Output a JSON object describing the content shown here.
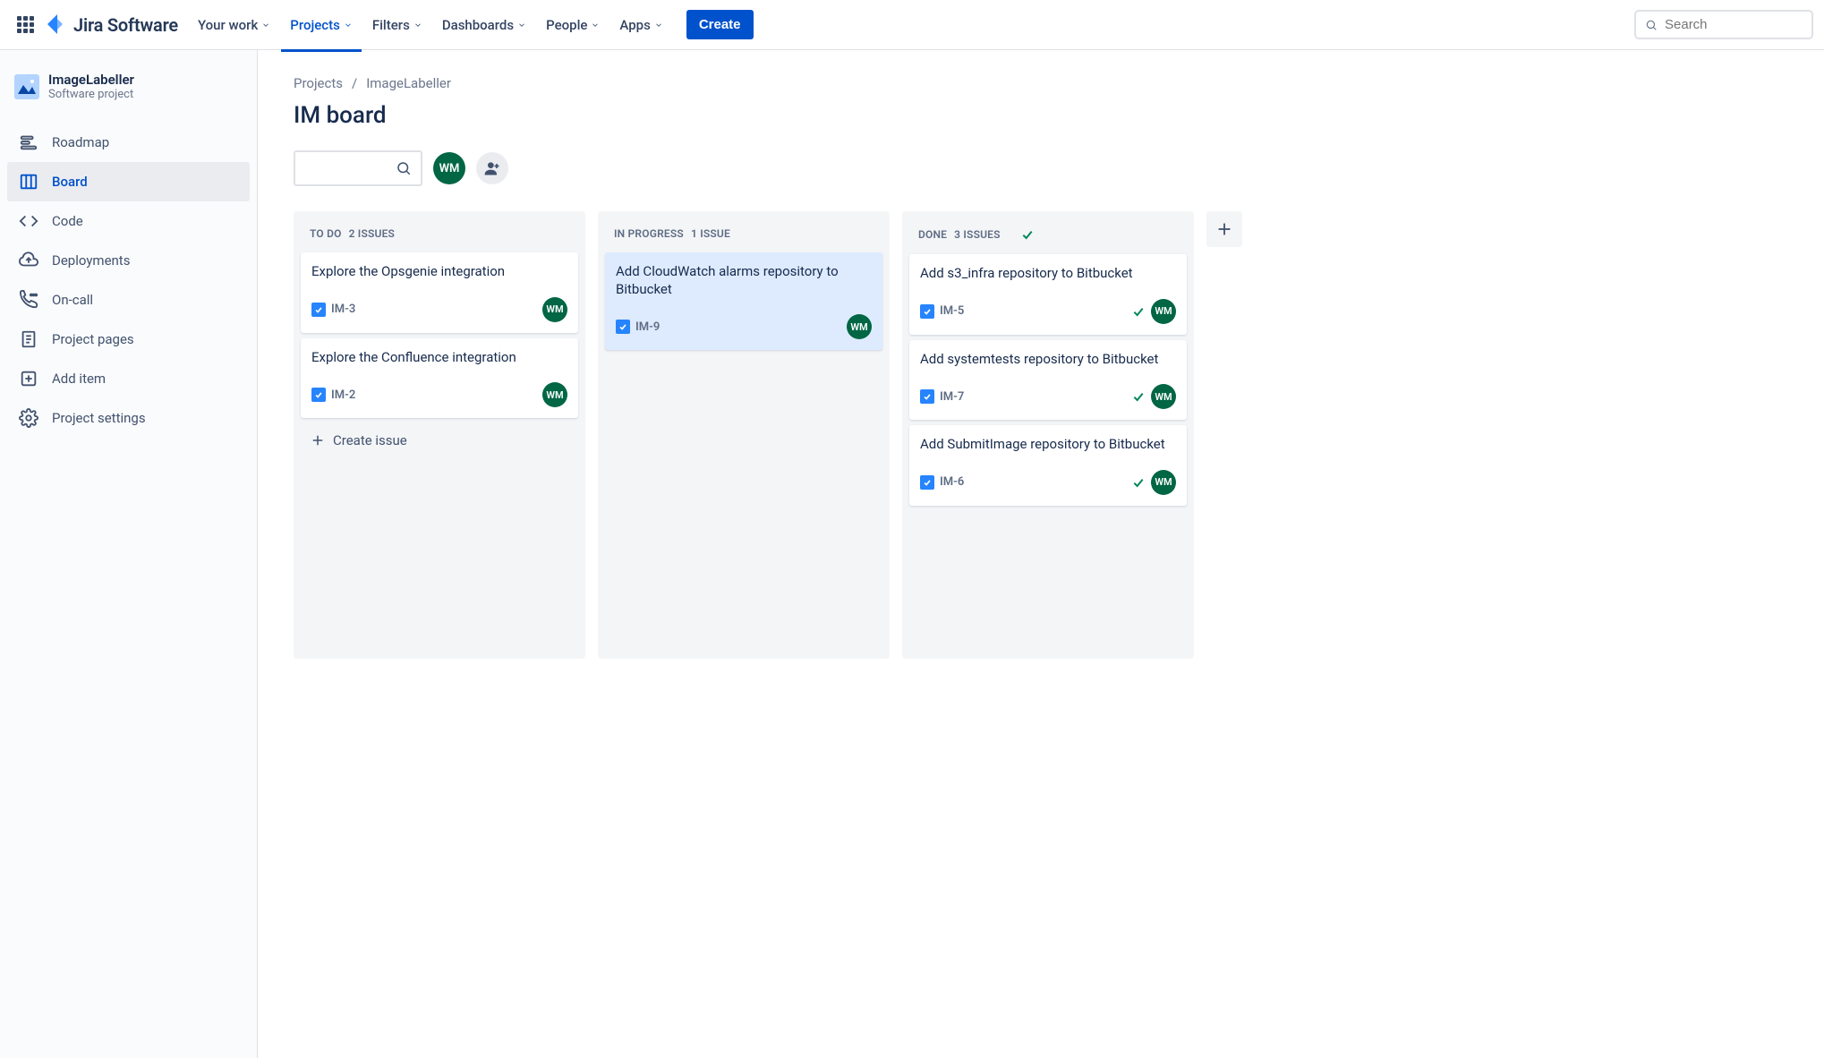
{
  "topnav": {
    "logo_text": "Jira Software",
    "items": [
      {
        "label": "Your work",
        "active": false
      },
      {
        "label": "Projects",
        "active": true
      },
      {
        "label": "Filters",
        "active": false
      },
      {
        "label": "Dashboards",
        "active": false
      },
      {
        "label": "People",
        "active": false
      },
      {
        "label": "Apps",
        "active": false
      }
    ],
    "create_label": "Create",
    "search_placeholder": "Search"
  },
  "sidebar": {
    "project_name": "ImageLabeller",
    "project_type": "Software project",
    "items": [
      {
        "label": "Roadmap",
        "icon": "roadmap"
      },
      {
        "label": "Board",
        "icon": "board"
      },
      {
        "label": "Code",
        "icon": "code"
      },
      {
        "label": "Deployments",
        "icon": "deploy"
      },
      {
        "label": "On-call",
        "icon": "oncall"
      },
      {
        "label": "Project pages",
        "icon": "pages"
      },
      {
        "label": "Add item",
        "icon": "add"
      },
      {
        "label": "Project settings",
        "icon": "settings"
      }
    ],
    "active_index": 1
  },
  "breadcrumb": {
    "root": "Projects",
    "project": "ImageLabeller"
  },
  "page_title": "IM board",
  "avatar_initials": "WM",
  "columns": [
    {
      "title": "TO DO",
      "count_label": "2 ISSUES",
      "done": false,
      "cards": [
        {
          "title": "Explore the Opsgenie integration",
          "key": "IM-3",
          "assignee": "WM",
          "done": false,
          "selected": false
        },
        {
          "title": "Explore the Confluence integration",
          "key": "IM-2",
          "assignee": "WM",
          "done": false,
          "selected": false
        }
      ],
      "create_label": "Create issue"
    },
    {
      "title": "IN PROGRESS",
      "count_label": "1 ISSUE",
      "done": false,
      "cards": [
        {
          "title": "Add CloudWatch alarms repository to Bitbucket",
          "key": "IM-9",
          "assignee": "WM",
          "done": false,
          "selected": true
        }
      ]
    },
    {
      "title": "DONE",
      "count_label": "3 ISSUES",
      "done": true,
      "cards": [
        {
          "title": "Add s3_infra repository to Bitbucket",
          "key": "IM-5",
          "assignee": "WM",
          "done": true,
          "selected": false
        },
        {
          "title": "Add systemtests repository to Bitbucket",
          "key": "IM-7",
          "assignee": "WM",
          "done": true,
          "selected": false
        },
        {
          "title": "Add SubmitImage repository to Bitbucket",
          "key": "IM-6",
          "assignee": "WM",
          "done": true,
          "selected": false
        }
      ]
    }
  ]
}
